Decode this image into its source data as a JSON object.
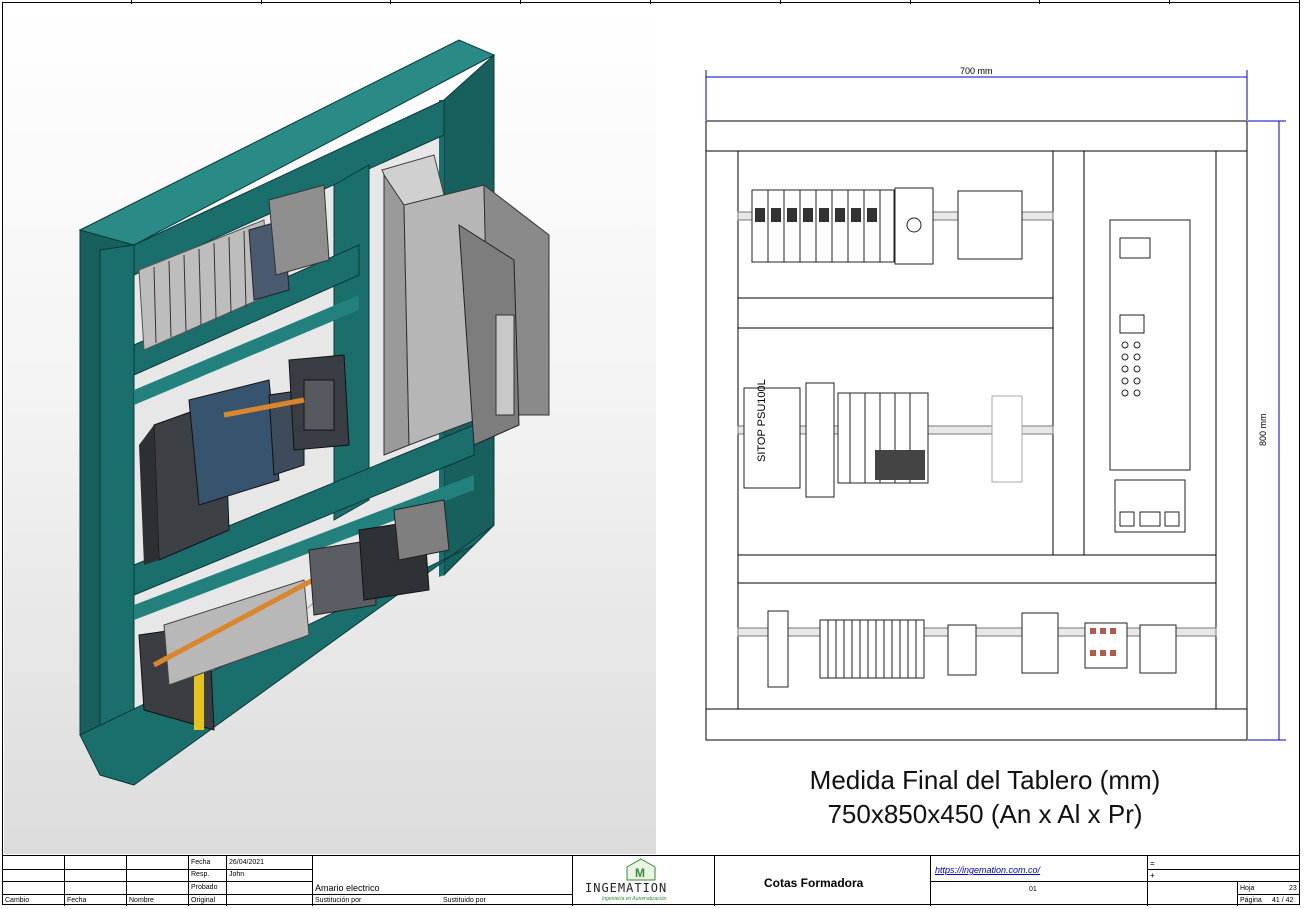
{
  "drawing": {
    "width_dim": "700 mm",
    "height_dim": "800 mm",
    "caption_line1": "Medida Final del Tablero (mm)",
    "caption_line2": "750x850x450 (An x Al x Pr)",
    "psu_label": "SITOP PSU100L"
  },
  "title_block": {
    "fecha_label": "Fecha",
    "fecha_value": "26/04/2021",
    "resp_label": "Resp.",
    "resp_value": "John",
    "probado_label": "Probado",
    "original_label": "Original",
    "cambio_label": "Cambio",
    "fecha_col_label": "Fecha",
    "nombre_label": "Nombre",
    "project_name": "Amario electrico",
    "sustitucion_label": "Sustitución por",
    "sustituido_label": "Sustituido por",
    "logo_text": "INGEMATION",
    "logo_sub": "Ingeniería en Automatización",
    "sheet_title": "Cotas Formadora",
    "url": "https://ingemation.com.co/",
    "code": "01",
    "eq": "=",
    "plus": "+",
    "hoja_label": "Hoja",
    "hoja_value": "23",
    "pagina_label": "Página",
    "pagina_value": "41 / 42"
  },
  "colors": {
    "frame_teal": "#1a6f6c",
    "frame_teal_dark": "#0f4d4b",
    "dimension_blue": "#0000cc",
    "copper": "#d9862c"
  }
}
